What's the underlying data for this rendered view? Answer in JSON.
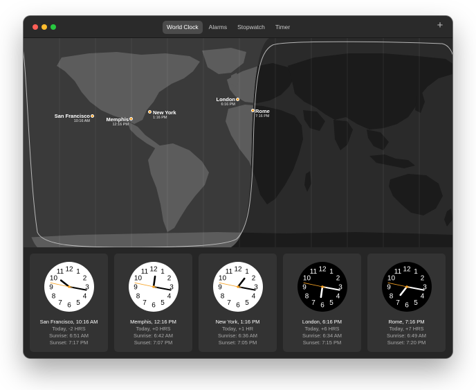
{
  "window": {
    "tabs": [
      {
        "label": "World Clock",
        "active": true
      },
      {
        "label": "Alarms",
        "active": false
      },
      {
        "label": "Stopwatch",
        "active": false
      },
      {
        "label": "Timer",
        "active": false
      }
    ],
    "add_label": "+"
  },
  "colors": {
    "accent": "#f7a325",
    "window_bg": "#262626",
    "card_bg": "#333333",
    "land_day": "#5a5a5a",
    "land_night": "#1c1c1c"
  },
  "map": {
    "cities": [
      {
        "name": "San Francisco",
        "time": "10:16 AM"
      },
      {
        "name": "Memphis",
        "time": "12:16 PM"
      },
      {
        "name": "New York",
        "time": "1:16 PM"
      },
      {
        "name": "London",
        "time": "6:16 PM"
      },
      {
        "name": "Rome",
        "time": "7:16 PM"
      }
    ]
  },
  "clocks": [
    {
      "title": "San Francisco, 10:16 AM",
      "offset": "Today, -2 HRS",
      "sunrise": "Sunrise: 6:51 AM",
      "sunset": "Sunset: 7:17 PM",
      "hour": 10,
      "minute": 16,
      "second": 47,
      "night": false
    },
    {
      "title": "Memphis, 12:16 PM",
      "offset": "Today, +0 HRS",
      "sunrise": "Sunrise: 6:42 AM",
      "sunset": "Sunset: 7:07 PM",
      "hour": 12,
      "minute": 16,
      "second": 47,
      "night": false
    },
    {
      "title": "New York, 1:16 PM",
      "offset": "Today, +1 HR",
      "sunrise": "Sunrise: 6:36 AM",
      "sunset": "Sunset: 7:05 PM",
      "hour": 1,
      "minute": 16,
      "second": 47,
      "night": false
    },
    {
      "title": "London, 6:16 PM",
      "offset": "Today, +6 HRS",
      "sunrise": "Sunrise: 6:34 AM",
      "sunset": "Sunset: 7:15 PM",
      "hour": 6,
      "minute": 16,
      "second": 47,
      "night": true
    },
    {
      "title": "Rome, 7:16 PM",
      "offset": "Today, +7 HRS",
      "sunrise": "Sunrise: 6:49 AM",
      "sunset": "Sunset: 7:20 PM",
      "hour": 7,
      "minute": 16,
      "second": 47,
      "night": true
    }
  ]
}
